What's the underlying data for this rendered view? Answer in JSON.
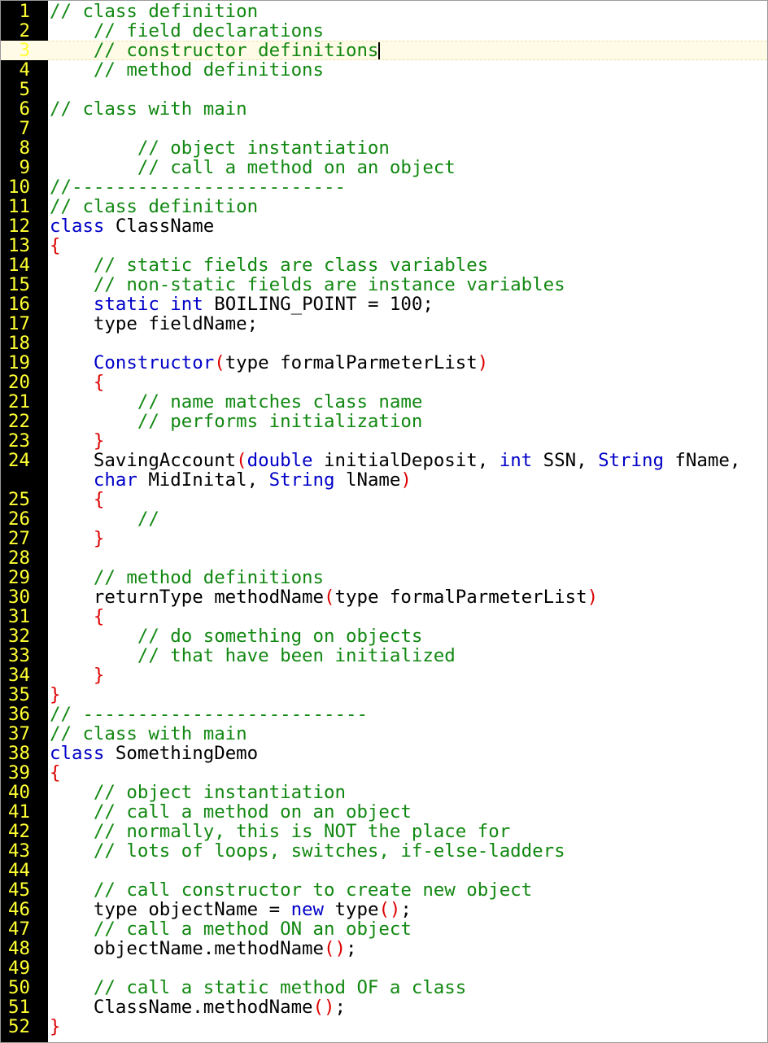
{
  "editor": {
    "current_line": 3,
    "colors": {
      "gutter_background": "#000000",
      "line_number": "#ffff33",
      "comment": "#118811",
      "keyword": "#0000c8",
      "bracket": "#dd0000",
      "text": "#000000",
      "current_line_highlight": "#fffbe6"
    },
    "lines": [
      {
        "n": "1",
        "tokens": [
          {
            "t": "// class definition",
            "k": "cmt"
          }
        ]
      },
      {
        "n": "2",
        "tokens": [
          {
            "t": "    // field declarations",
            "k": "cmt"
          }
        ]
      },
      {
        "n": "3",
        "tokens": [
          {
            "t": "    // constructor definitions",
            "k": "cmt"
          }
        ]
      },
      {
        "n": "4",
        "tokens": [
          {
            "t": "    // method definitions",
            "k": "cmt"
          }
        ]
      },
      {
        "n": "5",
        "tokens": []
      },
      {
        "n": "6",
        "tokens": [
          {
            "t": "// class with main",
            "k": "cmt"
          }
        ]
      },
      {
        "n": "7",
        "tokens": []
      },
      {
        "n": "8",
        "tokens": [
          {
            "t": "        // object instantiation",
            "k": "cmt"
          }
        ]
      },
      {
        "n": "9",
        "tokens": [
          {
            "t": "        // call a method on an object",
            "k": "cmt"
          }
        ]
      },
      {
        "n": "10",
        "tokens": [
          {
            "t": "//-------------------------",
            "k": "cmt"
          }
        ]
      },
      {
        "n": "11",
        "tokens": [
          {
            "t": "// class definition",
            "k": "cmt"
          }
        ]
      },
      {
        "n": "12",
        "tokens": [
          {
            "t": "class",
            "k": "kw"
          },
          {
            "t": " ClassName",
            "k": "tx"
          }
        ]
      },
      {
        "n": "13",
        "tokens": [
          {
            "t": "{",
            "k": "br"
          }
        ]
      },
      {
        "n": "14",
        "tokens": [
          {
            "t": "    // static fields are class variables",
            "k": "cmt"
          }
        ]
      },
      {
        "n": "15",
        "tokens": [
          {
            "t": "    // non-static fields are instance variables",
            "k": "cmt"
          }
        ]
      },
      {
        "n": "16",
        "tokens": [
          {
            "t": "    ",
            "k": "tx"
          },
          {
            "t": "static",
            "k": "kw"
          },
          {
            "t": " ",
            "k": "tx"
          },
          {
            "t": "int",
            "k": "kw"
          },
          {
            "t": " BOILING_POINT = 100;",
            "k": "tx"
          }
        ]
      },
      {
        "n": "17",
        "tokens": [
          {
            "t": "    type fieldName;",
            "k": "tx"
          }
        ]
      },
      {
        "n": "18",
        "tokens": []
      },
      {
        "n": "19",
        "tokens": [
          {
            "t": "    ",
            "k": "tx"
          },
          {
            "t": "Constructor",
            "k": "kw"
          },
          {
            "t": "(",
            "k": "br"
          },
          {
            "t": "type formalParmeterList",
            "k": "tx"
          },
          {
            "t": ")",
            "k": "br"
          }
        ]
      },
      {
        "n": "20",
        "tokens": [
          {
            "t": "    ",
            "k": "tx"
          },
          {
            "t": "{",
            "k": "br"
          }
        ]
      },
      {
        "n": "21",
        "tokens": [
          {
            "t": "        // name matches class name",
            "k": "cmt"
          }
        ]
      },
      {
        "n": "22",
        "tokens": [
          {
            "t": "        // performs initialization",
            "k": "cmt"
          }
        ]
      },
      {
        "n": "23",
        "tokens": [
          {
            "t": "    ",
            "k": "tx"
          },
          {
            "t": "}",
            "k": "br"
          }
        ]
      },
      {
        "n": "24",
        "tall": true,
        "tokens": [
          {
            "t": "    SavingAccount",
            "k": "tx"
          },
          {
            "t": "(",
            "k": "br"
          },
          {
            "t": "double",
            "k": "kw"
          },
          {
            "t": " initialDeposit, ",
            "k": "tx"
          },
          {
            "t": "int",
            "k": "kw"
          },
          {
            "t": " SSN, ",
            "k": "tx"
          },
          {
            "t": "String",
            "k": "kw"
          },
          {
            "t": " fName,",
            "k": "tx"
          },
          {
            "t": "\n    ",
            "k": "tx"
          },
          {
            "t": "char",
            "k": "kw"
          },
          {
            "t": " MidInital, ",
            "k": "tx"
          },
          {
            "t": "String",
            "k": "kw"
          },
          {
            "t": " lName",
            "k": "tx"
          },
          {
            "t": ")",
            "k": "br"
          }
        ]
      },
      {
        "n": "25",
        "tokens": [
          {
            "t": "    ",
            "k": "tx"
          },
          {
            "t": "{",
            "k": "br"
          }
        ]
      },
      {
        "n": "26",
        "tokens": [
          {
            "t": "        //",
            "k": "cmt"
          }
        ]
      },
      {
        "n": "27",
        "tokens": [
          {
            "t": "    ",
            "k": "tx"
          },
          {
            "t": "}",
            "k": "br"
          }
        ]
      },
      {
        "n": "28",
        "tokens": []
      },
      {
        "n": "29",
        "tokens": [
          {
            "t": "    // method definitions",
            "k": "cmt"
          }
        ]
      },
      {
        "n": "30",
        "tokens": [
          {
            "t": "    returnType methodName",
            "k": "tx"
          },
          {
            "t": "(",
            "k": "br"
          },
          {
            "t": "type formalParmeterList",
            "k": "tx"
          },
          {
            "t": ")",
            "k": "br"
          }
        ]
      },
      {
        "n": "31",
        "tokens": [
          {
            "t": "    ",
            "k": "tx"
          },
          {
            "t": "{",
            "k": "br"
          }
        ]
      },
      {
        "n": "32",
        "tokens": [
          {
            "t": "        // do something on objects",
            "k": "cmt"
          }
        ]
      },
      {
        "n": "33",
        "tokens": [
          {
            "t": "        // that have been initialized",
            "k": "cmt"
          }
        ]
      },
      {
        "n": "34",
        "tokens": [
          {
            "t": "    ",
            "k": "tx"
          },
          {
            "t": "}",
            "k": "br"
          }
        ]
      },
      {
        "n": "35",
        "tokens": [
          {
            "t": "}",
            "k": "br"
          }
        ]
      },
      {
        "n": "36",
        "tokens": [
          {
            "t": "// --------------------------",
            "k": "cmt"
          }
        ]
      },
      {
        "n": "37",
        "tokens": [
          {
            "t": "// class with main",
            "k": "cmt"
          }
        ]
      },
      {
        "n": "38",
        "tokens": [
          {
            "t": "class",
            "k": "kw"
          },
          {
            "t": " SomethingDemo",
            "k": "tx"
          }
        ]
      },
      {
        "n": "39",
        "tokens": [
          {
            "t": "{",
            "k": "br"
          }
        ]
      },
      {
        "n": "40",
        "tokens": [
          {
            "t": "    // object instantiation",
            "k": "cmt"
          }
        ]
      },
      {
        "n": "41",
        "tokens": [
          {
            "t": "    // call a method on an object",
            "k": "cmt"
          }
        ]
      },
      {
        "n": "42",
        "tokens": [
          {
            "t": "    // normally, this is NOT the place for",
            "k": "cmt"
          }
        ]
      },
      {
        "n": "43",
        "tokens": [
          {
            "t": "    // lots of loops, switches, if-else-ladders",
            "k": "cmt"
          }
        ]
      },
      {
        "n": "44",
        "tokens": []
      },
      {
        "n": "45",
        "tokens": [
          {
            "t": "    // call constructor to create new object",
            "k": "cmt"
          }
        ]
      },
      {
        "n": "46",
        "tokens": [
          {
            "t": "    type objectName = ",
            "k": "tx"
          },
          {
            "t": "new",
            "k": "kw"
          },
          {
            "t": " type",
            "k": "tx"
          },
          {
            "t": "()",
            "k": "br"
          },
          {
            "t": ";",
            "k": "tx"
          }
        ]
      },
      {
        "n": "47",
        "tokens": [
          {
            "t": "    // call a method ON an object",
            "k": "cmt"
          }
        ]
      },
      {
        "n": "48",
        "tokens": [
          {
            "t": "    objectName.methodName",
            "k": "tx"
          },
          {
            "t": "()",
            "k": "br"
          },
          {
            "t": ";",
            "k": "tx"
          }
        ]
      },
      {
        "n": "49",
        "tokens": []
      },
      {
        "n": "50",
        "tokens": [
          {
            "t": "    // call a static method OF a class",
            "k": "cmt"
          }
        ]
      },
      {
        "n": "51",
        "tokens": [
          {
            "t": "    ClassName.methodName",
            "k": "tx"
          },
          {
            "t": "()",
            "k": "br"
          },
          {
            "t": ";",
            "k": "tx"
          }
        ]
      },
      {
        "n": "52",
        "tokens": [
          {
            "t": "}",
            "k": "br"
          }
        ]
      }
    ]
  }
}
